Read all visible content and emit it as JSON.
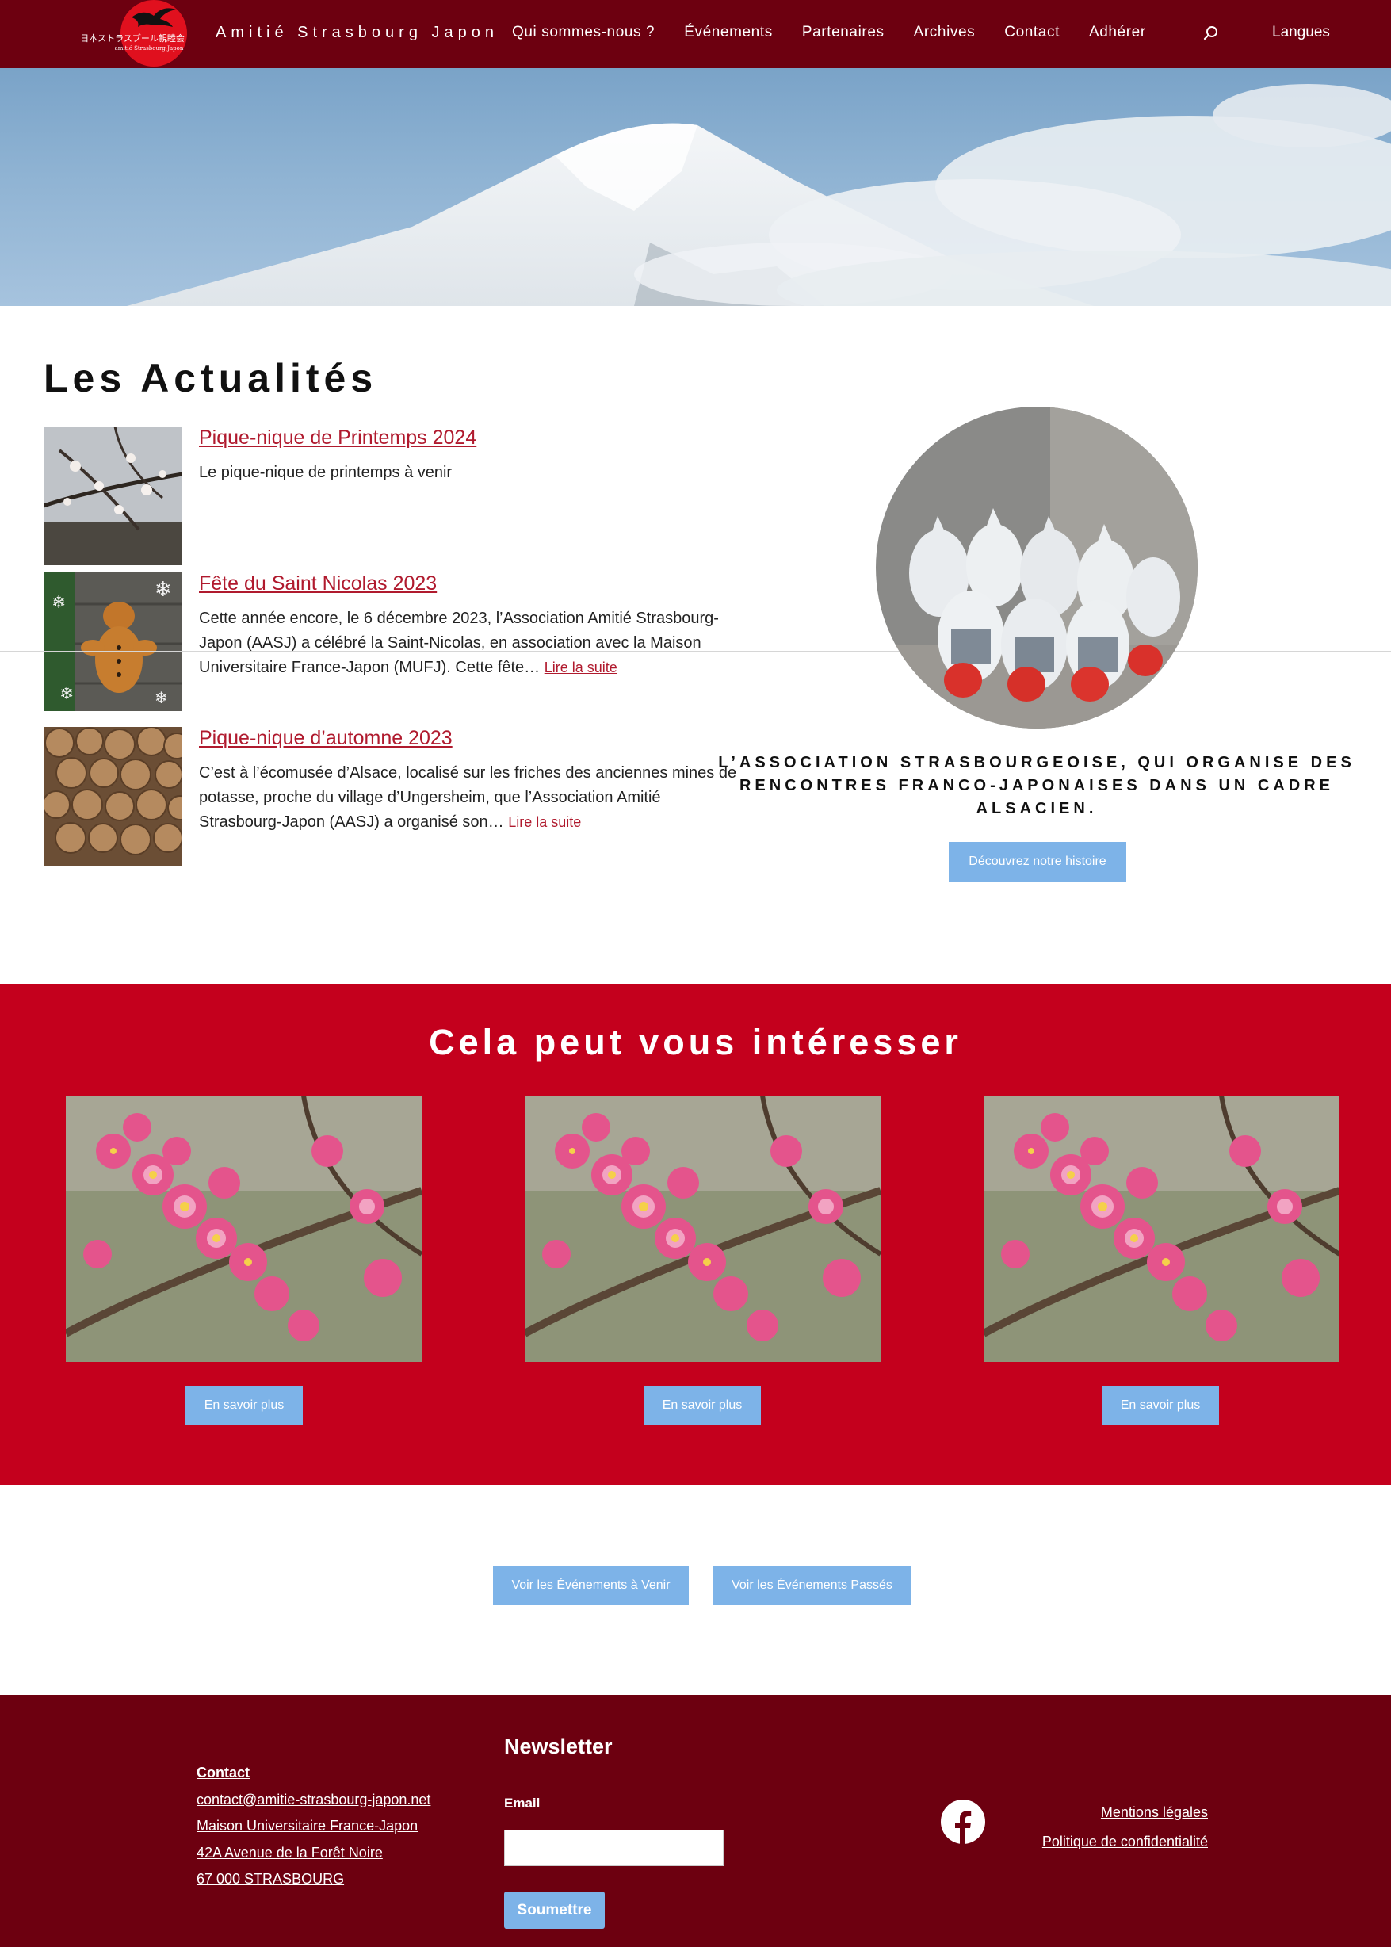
{
  "header": {
    "logo_jp": "日本ストラスブール親睦会",
    "logo_sub": "amitié Strasbourg-Japon",
    "site_title": "Amitié Strasbourg Japon",
    "nav": [
      "Qui sommes-nous ?",
      "Événements",
      "Partenaires",
      "Archives",
      "Contact",
      "Adhérer"
    ],
    "search_icon": "search-icon",
    "languages": "Langues"
  },
  "news": {
    "title": "Les Actualités",
    "items": [
      {
        "title": "Pique-nique de Printemps 2024",
        "excerpt": "Le pique-nique de printemps à venir",
        "read_more": ""
      },
      {
        "title": "Fête du Saint Nicolas 2023",
        "excerpt": "Cette année encore, le 6 décembre 2023, l’Association Amitié Strasbourg-Japon (AASJ) a célébré la Saint-Nicolas, en association avec la Maison Universitaire France-Japon (MUFJ). Cette fête…",
        "read_more": "Lire la suite"
      },
      {
        "title": "Pique-nique d’automne 2023",
        "excerpt": "C’est à l’écomusée d’Alsace, localisé sur les friches des anciennes mines de potasse, proche du village d’Ungersheim, que l’Association Amitié Strasbourg-Japon (AASJ) a organisé son…",
        "read_more": "Lire la suite"
      }
    ]
  },
  "association": {
    "tagline": "L’ASSOCIATION STRASBOURGEOISE, QUI ORGANISE DES RENCONTRES FRANCO-JAPONAISES DANS UN CADRE ALSACIEN.",
    "button": "Découvrez notre histoire"
  },
  "interest": {
    "title": "Cela peut vous intéresser",
    "cards": [
      {
        "button": "En savoir plus"
      },
      {
        "button": "En savoir plus"
      },
      {
        "button": "En savoir plus"
      }
    ]
  },
  "events": {
    "upcoming": "Voir les Événements à Venir",
    "past": "Voir les Événements Passés"
  },
  "footer": {
    "contact": {
      "heading": "Contact",
      "email": "contact@amitie-strasbourg-japon.net",
      "line1": "Maison Universitaire France-Japon",
      "line2": "42A Avenue de la Forêt Noire",
      "line3": "67 000 STRASBOURG"
    },
    "newsletter": {
      "title": "Newsletter",
      "email_label": "Email",
      "email_value": "",
      "submit": "Soumettre"
    },
    "facebook_icon": "facebook-icon",
    "legal": [
      "Mentions légales",
      "Politique de confidentialité"
    ]
  },
  "colors": {
    "header_bg": "#6d0010",
    "section_red": "#c4001d",
    "button_blue": "#7db3e8",
    "link_red": "#b01a2e"
  }
}
